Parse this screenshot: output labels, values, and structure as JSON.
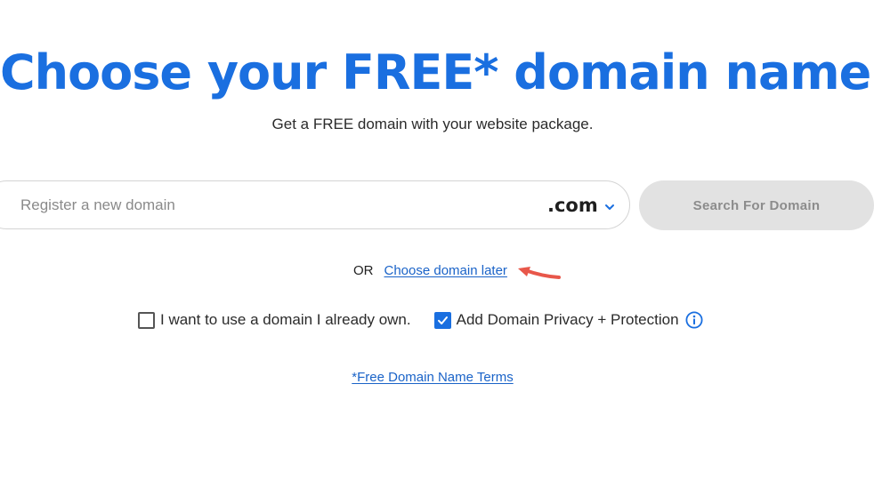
{
  "header": {
    "title": "Choose your FREE* domain name",
    "subtitle": "Get a FREE domain with your website package."
  },
  "search": {
    "placeholder": "Register a new domain",
    "value": "",
    "tld_selected": ".com",
    "tld_icon": "chevron-down-icon",
    "button_label": "Search For Domain"
  },
  "alternative": {
    "or_label": "OR",
    "link_label": "Choose domain later",
    "annotation_icon": "red-arrow-icon"
  },
  "options": {
    "own_domain": {
      "label": "I want to use a domain I already own.",
      "checked": false
    },
    "privacy": {
      "label": "Add Domain Privacy + Protection",
      "checked": true,
      "info_icon": "info-icon"
    }
  },
  "footer": {
    "terms_link": "*Free Domain Name Terms"
  },
  "colors": {
    "brand_blue": "#1a6fe0",
    "link_blue": "#1a63c8",
    "button_bg": "#e2e2e2",
    "button_text": "#8c8c8c",
    "annotation_red": "#e8574a"
  }
}
